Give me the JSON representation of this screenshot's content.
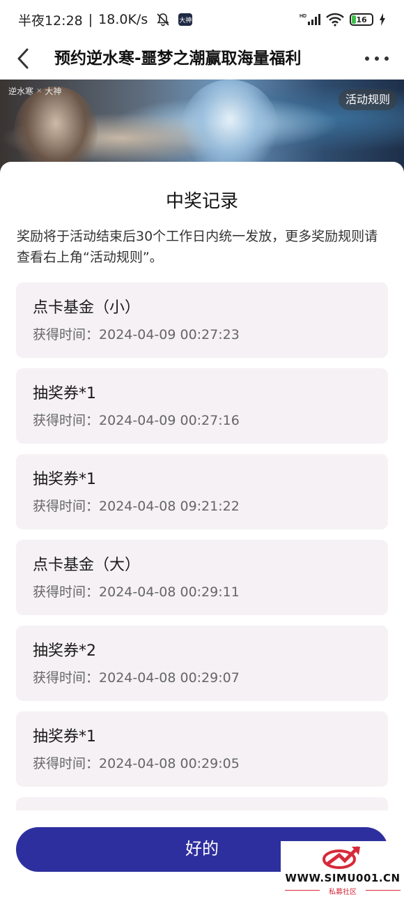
{
  "status_bar": {
    "time": "半夜12:28",
    "separator": "|",
    "net_speed": "18.0K/s",
    "badge_text": "大神",
    "hd_label": "HD",
    "battery_level": "16"
  },
  "nav": {
    "title": "预约逆水寒-噩梦之潮赢取海量福利"
  },
  "banner": {
    "logo_left": "逆水寒",
    "logo_x": "×",
    "logo_right": "大神",
    "rules_label": "活动规则"
  },
  "sheet": {
    "title": "中奖记录",
    "description": "奖励将于活动结束后30个工作日内统一发放，更多奖励规则请查看右上角“活动规则”。",
    "time_label": "获得时间：",
    "records": [
      {
        "name": "点卡基金（小）",
        "time": "2024-04-09 00:27:23"
      },
      {
        "name": "抽奖券*1",
        "time": "2024-04-09 00:27:16"
      },
      {
        "name": "抽奖券*1",
        "time": "2024-04-08 09:21:22"
      },
      {
        "name": "点卡基金（大）",
        "time": "2024-04-08 00:29:11"
      },
      {
        "name": "抽奖券*2",
        "time": "2024-04-08 00:29:07"
      },
      {
        "name": "抽奖券*1",
        "time": "2024-04-08 00:29:05"
      },
      {
        "name": "",
        "time": ""
      }
    ],
    "ok_label": "好的"
  },
  "watermark": {
    "url": "WWW.SIMU001.CN",
    "subtitle": "私募社区"
  },
  "colors": {
    "primary_button": "#2e2f9e",
    "card_background": "#f5f1f4",
    "watermark_red": "#d62a3a"
  }
}
